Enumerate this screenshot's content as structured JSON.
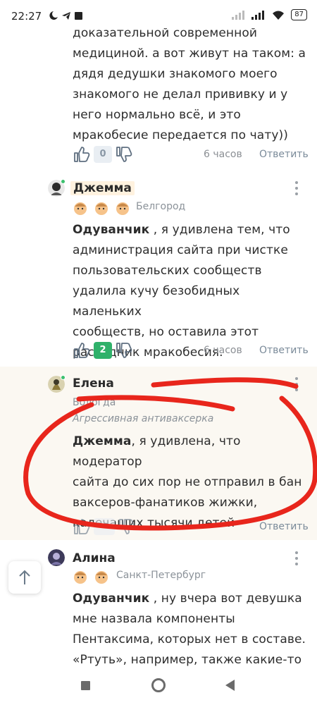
{
  "status_bar": {
    "time": "22:27",
    "battery": "87"
  },
  "comments": [
    {
      "text_lines": [
        "доказательной современной",
        "медициной. а вот живут на таком: а",
        "дядя дедушки знакомого моего",
        "знакомого не делал прививку и у",
        "него нормально всё, и это",
        "мракобесие передается по чату))"
      ],
      "likes": "0",
      "time": "6 часов",
      "reply": "Ответить"
    },
    {
      "author": "Джемма",
      "city": "Белгород",
      "mention": "Одуванчик",
      "text_first": " , я удивлена тем, что",
      "text_lines": [
        "администрация сайта при чистке",
        "пользовательских сообществ",
        "удалила кучу безобидных маленьких",
        "сообществ, но оставила этот",
        "рассадник мракобесия."
      ],
      "likes": "2",
      "time": "6 часов",
      "reply": "Ответить"
    },
    {
      "author": "Елена",
      "city": "Вологда",
      "status": "Агрессивная антиваксерка",
      "mention": "Джемма",
      "text_first": ", я удивлена, что модератор",
      "text_lines": [
        "сайта до сих пор не отправил в бан",
        "ваксеров-фанатиков жижки,",
        "калечащих тысячи детей"
      ],
      "time": "",
      "reply": "Ответить"
    },
    {
      "author": "Алина",
      "city": "Санкт-Петербург",
      "mention": "Одуванчик",
      "text_first": " , ну вчера вот девушка",
      "text_lines": [
        "мне назвала компоненты",
        "Пентаксима, которых нет в составе.",
        "«Ртуть», например, также какие-то"
      ]
    }
  ],
  "icons": {
    "like": "thumb-up-icon",
    "dislike": "thumb-down-icon",
    "more": "kebab-icon",
    "scroll_top": "arrow-up-icon"
  },
  "colors": {
    "positive": "#2fb16a",
    "annotation_red": "#e8261c",
    "highlight": "#fbf8f2"
  }
}
